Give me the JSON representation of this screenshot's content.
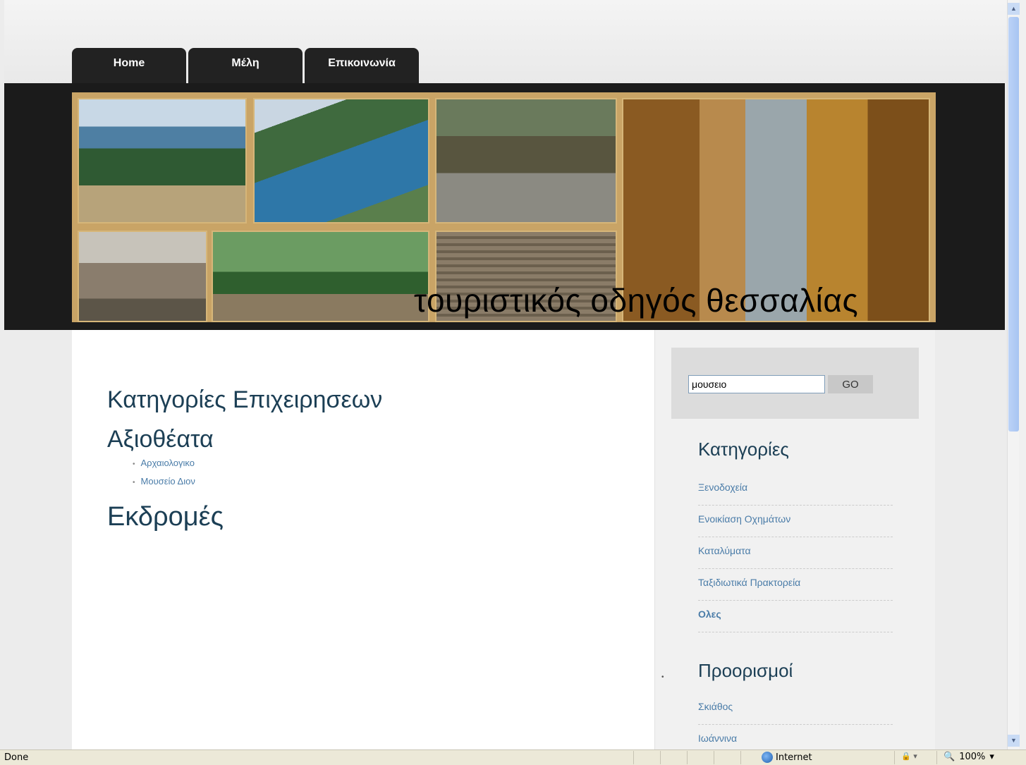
{
  "nav": {
    "tabs": [
      {
        "label": "Home"
      },
      {
        "label": "Μέλη"
      },
      {
        "label": "Επικοινωνία"
      }
    ]
  },
  "banner": {
    "title": "τουριστικός οδηγός θεσσαλίας"
  },
  "main": {
    "categories_heading": "Κατηγορίες Επιχειρησεων",
    "sights_heading": "Αξιοθέατα",
    "sights_items": [
      "Αρχαιολογικο",
      "Μουσείο Διον"
    ],
    "trips_heading": "Εκδρομές"
  },
  "search": {
    "value": "μουσειο",
    "go_label": "GO"
  },
  "sidebar": {
    "categories_heading": "Κατηγορίες",
    "categories": [
      "Ξενοδοχεία",
      "Ενοικίαση Οχημάτων",
      "Καταλύματα",
      "Ταξιδιωτικά Πρακτορεία",
      "Ολες"
    ],
    "destinations_heading": "Προορισμοί",
    "destinations": [
      "Σκιάθος",
      "Ιωάννινα"
    ]
  },
  "statusbar": {
    "status": "Done",
    "zone": "Internet",
    "zoom": "100%"
  },
  "colors": {
    "heading": "#1c3f55",
    "link": "#4a7ca8",
    "nav_bg": "#222222",
    "header_band": "#1b1b1b"
  }
}
